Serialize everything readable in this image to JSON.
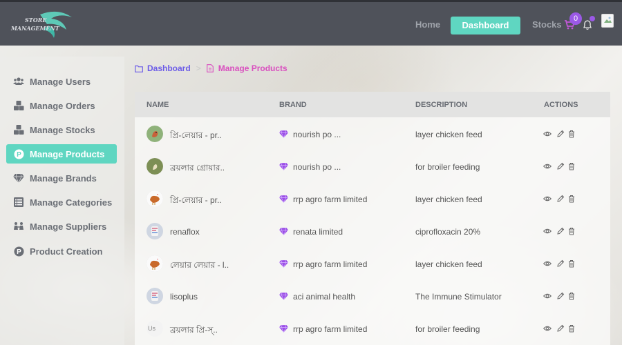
{
  "brand": {
    "logo_line1": "STORE",
    "logo_line2": "MANAGEMENT"
  },
  "nav": {
    "home": "Home",
    "dashboard": "Dashboard",
    "stocks": "Stocks",
    "cart_count": "0"
  },
  "sidebar": {
    "items": [
      {
        "label": "Manage Users",
        "icon": "users-icon"
      },
      {
        "label": "Manage Orders",
        "icon": "boxes-icon"
      },
      {
        "label": "Manage Stocks",
        "icon": "boxes-icon"
      },
      {
        "label": "Manage Products",
        "icon": "product-p-icon",
        "active": true
      },
      {
        "label": "Manage Brands",
        "icon": "gem-icon"
      },
      {
        "label": "Manage Categories",
        "icon": "list-icon"
      },
      {
        "label": "Manage Suppliers",
        "icon": "suppliers-icon"
      },
      {
        "label": "Product Creation",
        "icon": "product-p-icon"
      }
    ]
  },
  "breadcrumb": {
    "root": "Dashboard",
    "current": "Manage Products"
  },
  "table": {
    "headers": {
      "name": "NAME",
      "brand": "BRAND",
      "description": "DESCRIPTION",
      "actions": "ACTIONS"
    },
    "rows": [
      {
        "name": "প্রি-লেয়ার - pr..",
        "brand": "nourish po ...",
        "description": "layer chicken feed",
        "image": "chick-green"
      },
      {
        "name": "ব্রয়লার গ্রোয়ার..",
        "brand": "nourish po ...",
        "description": "for broiler feeding",
        "image": "chick-olive"
      },
      {
        "name": "প্রি-লেয়ার - pr..",
        "brand": "rrp agro farm limited",
        "description": "layer chicken feed",
        "image": "hen"
      },
      {
        "name": "renaflox",
        "brand": "renata limited",
        "description": "ciprofloxacin 20%",
        "image": "medicine"
      },
      {
        "name": "লেয়ার লেয়ার - l..",
        "brand": "rrp agro farm limited",
        "description": "layer chicken feed",
        "image": "hen"
      },
      {
        "name": "lisoplus",
        "brand": "aci animal health",
        "description": "The Immune Stimulator",
        "image": "medicine"
      },
      {
        "name": "ব্রয়লার প্রি-স্..",
        "brand": "rrp agro farm limited",
        "description": "for broiler feeding",
        "image": "broken",
        "image_alt": "Us"
      }
    ]
  },
  "colors": {
    "accent": "#5fd6c1",
    "purple": "#9b59e6",
    "breadcrumb_root": "#6c5ce7",
    "breadcrumb_current": "#d94fbf",
    "topbar": "#4f525a"
  }
}
